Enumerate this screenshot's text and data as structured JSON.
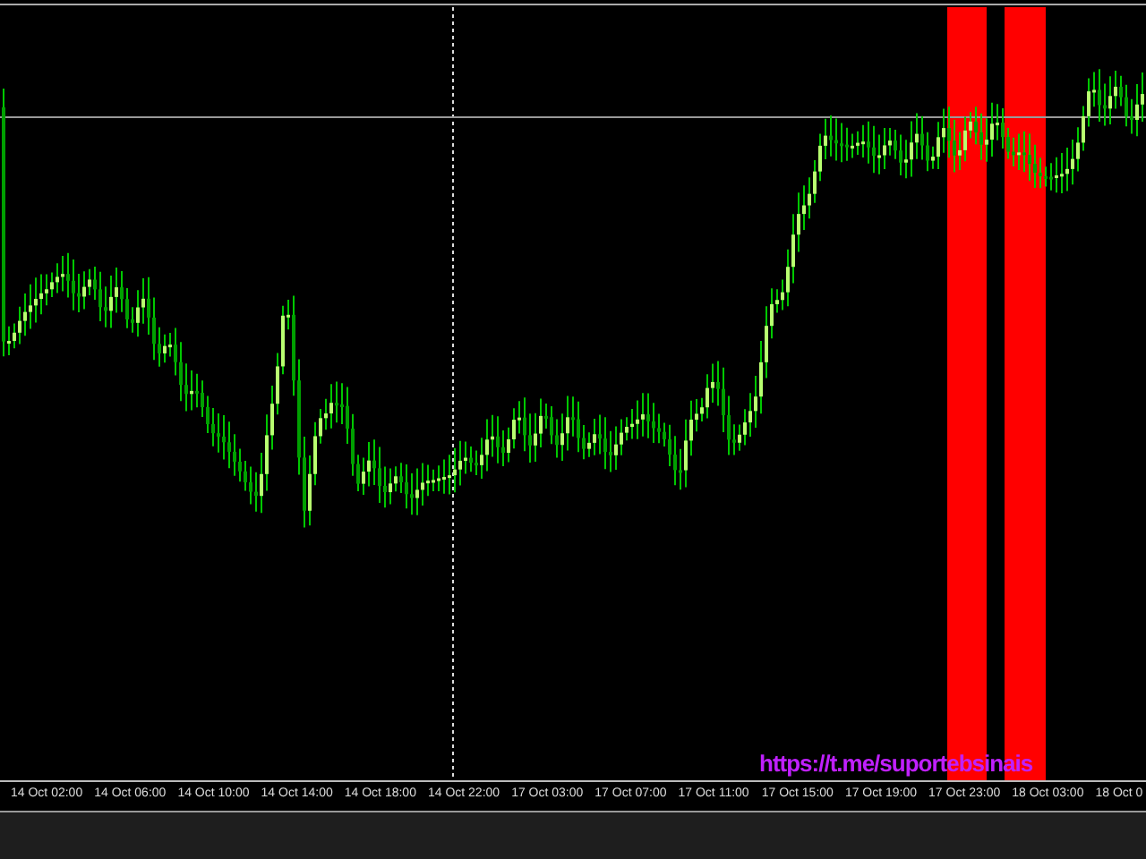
{
  "chart": {
    "link_label": "https://t.me/suportebsinais"
  },
  "time_axis": {
    "labels": [
      "14 Oct 02:00",
      "14 Oct 06:00",
      "14 Oct 10:00",
      "14 Oct 14:00",
      "14 Oct 18:00",
      "14 Oct 22:00",
      "17 Oct 03:00",
      "17 Oct 07:00",
      "17 Oct 11:00",
      "17 Oct 15:00",
      "17 Oct 19:00",
      "17 Oct 23:00",
      "18 Oct 03:00",
      "18 Oct 0"
    ]
  }
}
